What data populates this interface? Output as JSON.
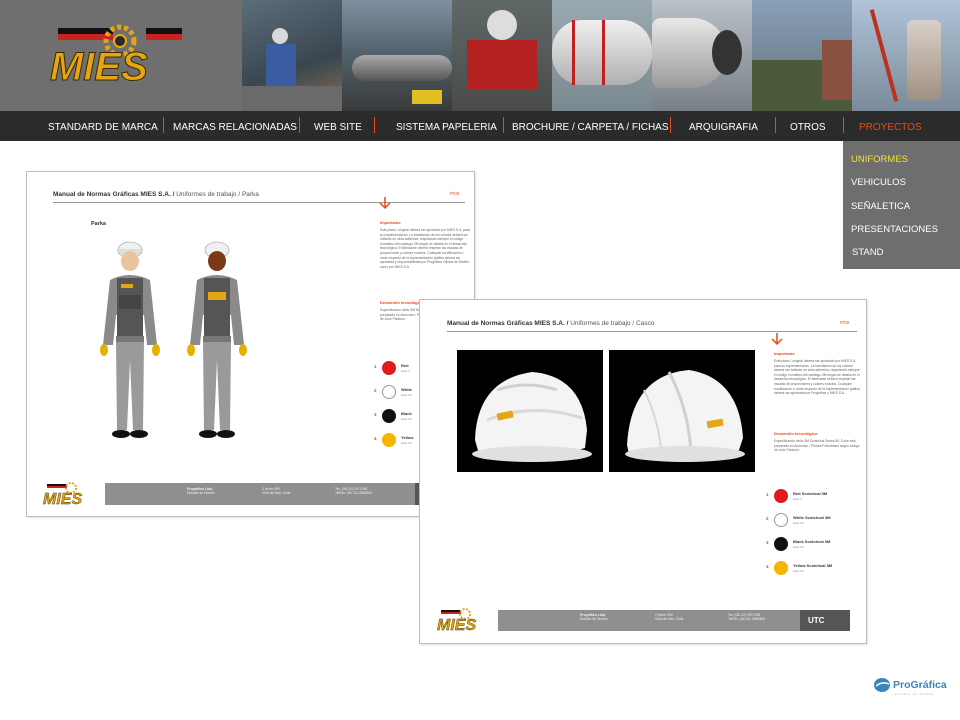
{
  "brand": {
    "logo_text": "MIES",
    "partner_name": "ProGráfica",
    "partner_tagline": "estudio de diseño",
    "colors": {
      "accent": "#e84a1a",
      "logo_yellow": "#e6a614",
      "logo_red": "#c8231f",
      "dropdown_active": "#f5e03a"
    }
  },
  "header": {
    "photos": [
      "worker-photo",
      "pipe-machinery-photo",
      "red-machine-photo",
      "drum-rollers-photo",
      "steel-drum-photo",
      "plant-tower-photo",
      "crane-photo"
    ]
  },
  "nav": {
    "items": [
      {
        "label": "STANDARD DE MARCA",
        "active": false
      },
      {
        "label": "MARCAS RELACIONADAS",
        "active": false
      },
      {
        "label": "WEB SITE",
        "active": false
      },
      {
        "label": "SISTEMA PAPELERIA",
        "active": false
      },
      {
        "label": "BROCHURE / CARPETA / FICHAS",
        "active": false
      },
      {
        "label": "ARQUIGRAFIA",
        "active": false
      },
      {
        "label": "OTROS",
        "active": false
      },
      {
        "label": "PROYECTOS",
        "active": true
      }
    ]
  },
  "dropdown": {
    "items": [
      {
        "label": "UNIFORMES",
        "active": true
      },
      {
        "label": "VEHICULOS",
        "active": false
      },
      {
        "label": "SEÑALETICA",
        "active": false
      },
      {
        "label": "PRESENTACIONES",
        "active": false
      },
      {
        "label": "STAND",
        "active": false
      }
    ]
  },
  "sheet_parka": {
    "title": "Manual de Normas Gráficas MIES S.A.",
    "subtitle": "Uniformes de trabajo / Parka",
    "code": "P/00",
    "caption": "Parka",
    "side_head": "Importante",
    "side_text": "Este plano / original deberá ser aprobado por MIES S.A. para su implementación. La tramitación de los colores deberá ser brillante en cinta adhesiva, respetando siempre el código cromático del catálogo 3M según se detalla en el desarrollo tecnológico. El fabricante deberá respetar las escalas de proporciones y colores exactos. Cualquier modificación o duda respecto de la implementación gráfica deberá ser aprobada y responsabilidad por Prográfica Oficina de Diseño como por MIES S.A.",
    "side_head2": "Desarrollo tecnológico",
    "side_text2": "Especificación vinilo 3M Scotchcal Series 50. Color azul preparado en Autocolor / Pintura Poliuretano según código de color Pantone.",
    "swatches": [
      {
        "num": "1",
        "color": "#e11b1b",
        "label": "Red",
        "sub": "Serie 2"
      },
      {
        "num": "2",
        "color": "#ffffff",
        "label": "White",
        "sub": "Serie 50"
      },
      {
        "num": "3",
        "color": "#111111",
        "label": "Black",
        "sub": "Serie 50"
      },
      {
        "num": "4",
        "color": "#f5b400",
        "label": "Yellow",
        "sub": "Serie 50"
      }
    ],
    "footer": {
      "col1": [
        "Prográfica Ltda.",
        "Estudio de Diseño"
      ],
      "col2": [
        "2 Norte 990",
        "Viña del Mar. Chile"
      ],
      "col3": [
        "Tel.: (56-32) 2971255",
        "TelFax: (56-32) 2696363"
      ],
      "tag": "U"
    }
  },
  "sheet_casco": {
    "title": "Manual de Normas Gráficas MIES S.A.",
    "subtitle": "Uniformes de trabajo / Casco",
    "code": "P/00",
    "side_head": "Importante",
    "side_text": "Este plano / original deberá ser aprobado por MIES S.A. para su implementación. La tramitación de los colores deberá ser brillante en cinta adhesiva, respetando siempre el código cromático del catálogo 3M según se detalla en el desarrollo tecnológico. El fabricante deberá respetar las escalas de proporciones y colores exactos. Cualquier modificación o duda respecto de la implementación gráfica deberá ser aprobada por Prográfica y MIES S.A.",
    "side_head2": "Desarrollo tecnológico",
    "side_text2": "Especificación vinilo 3M Scotchcal Series 50. Color azul preparado en Autocolor / Pintura Poliuretano según código de color Pantone.",
    "swatches": [
      {
        "num": "1",
        "color": "#e11b1b",
        "label": "Red Scotchcal 3M",
        "sub": "Serie 2"
      },
      {
        "num": "2",
        "color": "#ffffff",
        "label": "White Scotchcal 3M",
        "sub": "Serie 50"
      },
      {
        "num": "3",
        "color": "#111111",
        "label": "Black Scotchcal 3M",
        "sub": "Serie 50"
      },
      {
        "num": "4",
        "color": "#f5b400",
        "label": "Yellow Scotchcal 3M",
        "sub": "Serie 50"
      }
    ],
    "footer": {
      "col1": [
        "Prográfica Ltda.",
        "Estudio de Diseño"
      ],
      "col2": [
        "2 Norte 990",
        "Viña del Mar. Chile"
      ],
      "col3": [
        "Tel.: (56-32) 2971255",
        "TelFax: (56-32) 2696363"
      ],
      "tag": "UTC"
    }
  }
}
